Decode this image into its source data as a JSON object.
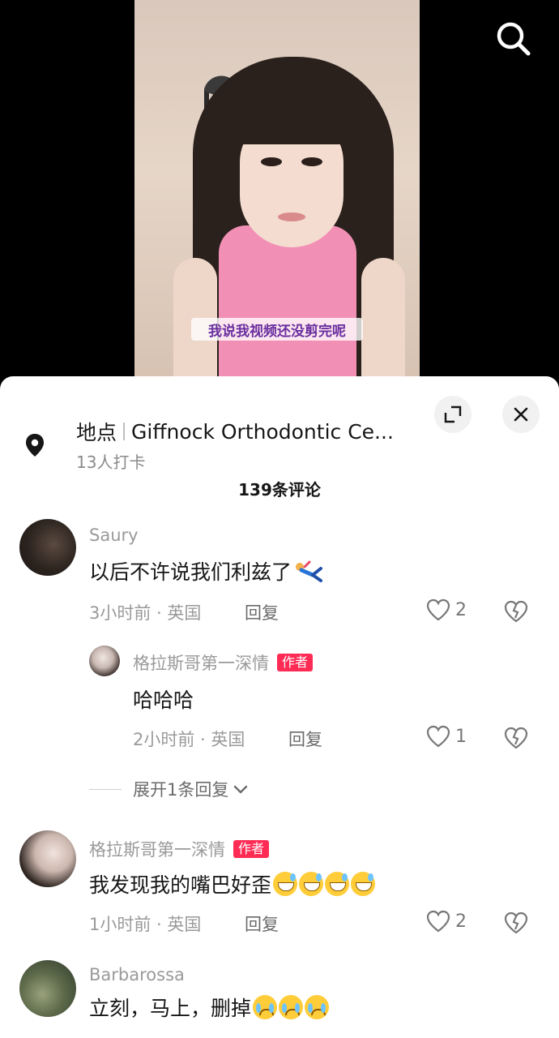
{
  "video": {
    "subtitle": "我说我视频还没剪完呢"
  },
  "location": {
    "prefix": "地点",
    "name": "Giffnock Orthodontic Ce...",
    "checkins": "13人打卡"
  },
  "comments_header": {
    "count_label": "139条评论"
  },
  "comments": [
    {
      "username": "Saury",
      "text": "以后不许说我们利兹了",
      "emoji": "falling-person",
      "meta": "3小时前 · 英国",
      "reply_label": "回复",
      "likes": "2",
      "is_author": false
    },
    {
      "username": "格拉斯哥第一深情",
      "badge": "作者",
      "text": "哈哈哈",
      "meta": "2小时前 · 英国",
      "reply_label": "回复",
      "likes": "1",
      "is_author": true,
      "is_reply": true
    },
    {
      "username": "格拉斯哥第一深情",
      "badge": "作者",
      "text": "我发现我的嘴巴好歪",
      "emoji": "grin-sweat x4",
      "meta": "1小时前 · 英国",
      "reply_label": "回复",
      "likes": "2",
      "is_author": true
    },
    {
      "username": "Barbarossa",
      "text": "立刻，马上，删掉",
      "emoji": "pleading-cry x3",
      "is_author": false
    }
  ],
  "expand_replies_label": "展开1条回复",
  "colors": {
    "author_badge": "#fe2c55",
    "panel_bg": "#ffffff",
    "muted_text": "#9a9a9a",
    "subtitle_text": "#6a2fa0"
  },
  "icons": [
    "search-icon",
    "location-pin-icon",
    "expand-icon",
    "close-icon",
    "heart-icon",
    "broken-heart-icon",
    "chevron-down-icon"
  ]
}
